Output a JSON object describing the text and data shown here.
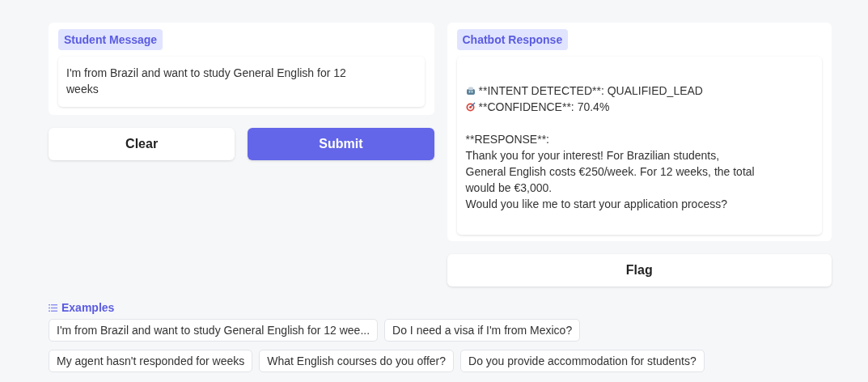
{
  "student_panel": {
    "label": "Student Message",
    "message": "I'm from Brazil and want to study General English for 12 weeks"
  },
  "buttons": [
    {
      "label": "Clear"
    },
    {
      "label": "Submit"
    }
  ],
  "chatbot_panel": {
    "label": "Chatbot Response",
    "lines": [
      {
        "kind": "icon_line",
        "text": "**INTENT DETECTED**: QUALIFIED_LEAD"
      },
      {
        "kind": "icon_line",
        "text": "**CONFIDENCE**: 70.4%"
      },
      {
        "kind": "gap"
      },
      {
        "text": "**RESPONSE**:"
      },
      {
        "text": "Thank you for your interest! For Brazilian students, General English costs €250/week. For 12 weeks, the total would be €3,000."
      },
      {
        "text": "Would you like me to start your application process?"
      }
    ]
  },
  "flag_button": {
    "label": "Flag"
  },
  "examples": {
    "title": "Examples",
    "items": [
      "I'm from Brazil and want to study General English for 12 wee...",
      "Do I need a visa if I'm from Mexico?",
      "My agent hasn't responded for weeks",
      "What English courses do you offer?",
      "Do you provide accommodation for students?"
    ]
  }
}
